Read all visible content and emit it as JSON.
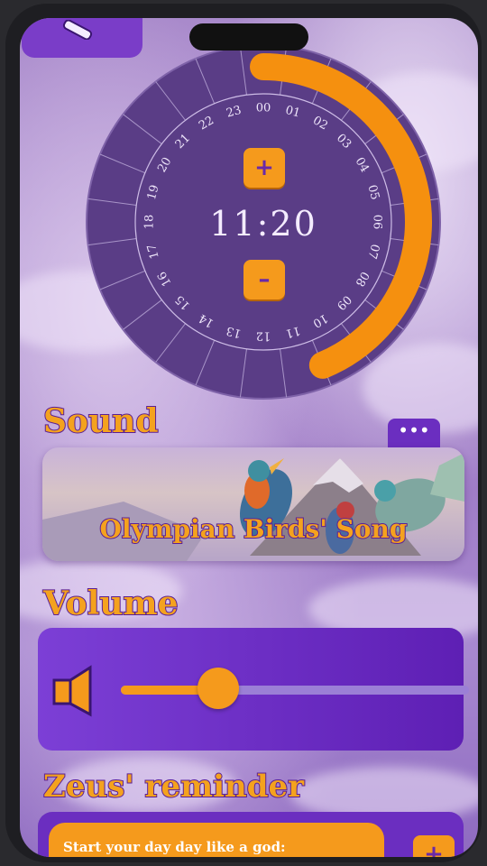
{
  "alarm": {
    "time": "11:20",
    "hour_labels": [
      "00",
      "01",
      "02",
      "03",
      "04",
      "05",
      "06",
      "07",
      "08",
      "09",
      "10",
      "11",
      "12",
      "13",
      "14",
      "15",
      "16",
      "17",
      "18",
      "19",
      "20",
      "21",
      "22",
      "23"
    ],
    "increment_symbol": "+",
    "decrement_symbol": "–",
    "arc_fraction_start_hour": 0,
    "arc_fraction_end_hour": 10.5
  },
  "sound": {
    "heading": "Sound",
    "more_symbol": "•••",
    "selected": "Olympian Birds' Song"
  },
  "volume": {
    "heading": "Volume",
    "level_fraction": 0.28
  },
  "reminder": {
    "heading": "Zeus' reminder",
    "text": "Start your day day like a god:",
    "add_symbol": "+"
  },
  "colors": {
    "accent": "#f59a1c",
    "primary_purple": "#6b2ec0",
    "heading_outline": "#5a1f96"
  }
}
